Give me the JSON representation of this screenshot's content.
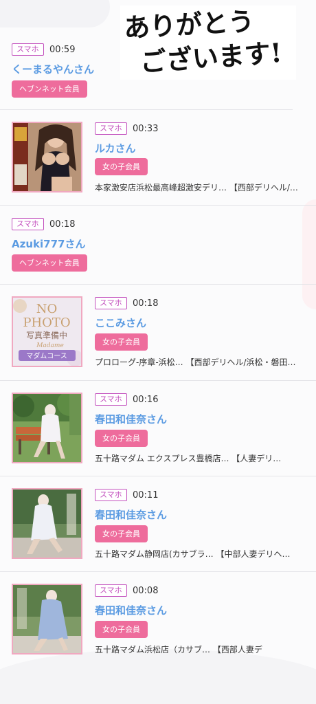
{
  "overlay": {
    "thanks_line1": "ありがとう",
    "thanks_line2": "ございます!"
  },
  "feed": [
    {
      "device": "スマホ",
      "time": "00:59",
      "name": "くーまるやんさん",
      "member_type": "ヘブンネット会員",
      "shop": "",
      "has_photo": false,
      "photo": "none"
    },
    {
      "device": "スマホ",
      "time": "00:33",
      "name": "ルカさん",
      "member_type": "女の子会員",
      "shop": "本家激安店浜松最高峰超激安デリ… 【西部デリヘル/…",
      "has_photo": true,
      "photo": "woman-black-swimsuit"
    },
    {
      "device": "スマホ",
      "time": "00:18",
      "name": "Azuki777さん",
      "member_type": "ヘブンネット会員",
      "shop": "",
      "has_photo": false,
      "photo": "none"
    },
    {
      "device": "スマホ",
      "time": "00:18",
      "name": "ここみさん",
      "member_type": "女の子会員",
      "shop": "プロローグ-序章-浜松… 【西部デリヘル/浜松・磐田…",
      "has_photo": true,
      "photo": "no-photo-placeholder",
      "photo_text": {
        "line1": "NO",
        "line2": "PHOTO",
        "line3": "写真準備中",
        "line4": "Madame",
        "line5": "マダムコース"
      }
    },
    {
      "device": "スマホ",
      "time": "00:16",
      "name": "春田和佳奈さん",
      "member_type": "女の子会員",
      "shop": "五十路マダム エクスプレス豊橋店… 【人妻デリ…",
      "has_photo": true,
      "photo": "woman-on-bench"
    },
    {
      "device": "スマホ",
      "time": "00:11",
      "name": "春田和佳奈さん",
      "member_type": "女の子会員",
      "shop": "五十路マダム静岡店(カサブラ… 【中部人妻デリヘ…",
      "has_photo": true,
      "photo": "woman-white-coat"
    },
    {
      "device": "スマホ",
      "time": "00:08",
      "name": "春田和佳奈さん",
      "member_type": "女の子会員",
      "shop": "五十路マダム浜松店（カサブ… 【西部人妻デ",
      "has_photo": true,
      "photo": "woman-blue-dress"
    }
  ],
  "colors": {
    "name": "#5b9be2",
    "member_badge": "#ee6c9c",
    "device_badge": "#c24fbd",
    "divider": "#e4e4e8",
    "thumb_border": "#f0a8c0"
  }
}
